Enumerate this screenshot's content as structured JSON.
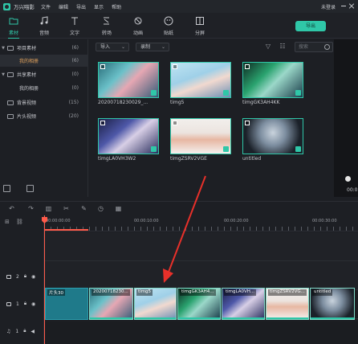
{
  "app": {
    "title": "万兴喵影",
    "menu": [
      "文件",
      "编辑",
      "导出",
      "显示",
      "帮助"
    ],
    "login": "未登录",
    "accent": "#2fc7a8"
  },
  "toolbar": {
    "tools": [
      {
        "label": "素材",
        "icon": "folder-icon"
      },
      {
        "label": "音频",
        "icon": "music-note-icon"
      },
      {
        "label": "文字",
        "icon": "text-icon"
      },
      {
        "label": "转场",
        "icon": "transition-icon"
      },
      {
        "label": "动画",
        "icon": "animation-icon"
      },
      {
        "label": "贴纸",
        "icon": "sticker-icon"
      },
      {
        "label": "分屏",
        "icon": "split-screen-icon"
      }
    ],
    "export_label": "导出"
  },
  "sidebar": {
    "items": [
      {
        "label": "项目素材",
        "count": "(6)"
      },
      {
        "label": "我的相册",
        "count": "(6)"
      },
      {
        "label": "共享素材",
        "count": "(0)"
      },
      {
        "label": "我的相册",
        "count": "(0)"
      },
      {
        "label": "背景视频",
        "count": "(15)"
      },
      {
        "label": "片头视频",
        "count": "(20)"
      }
    ]
  },
  "media": {
    "import_label": "导入",
    "sort_label": "录制",
    "search_placeholder": "搜索",
    "items": [
      {
        "name": "20200718230029_..."
      },
      {
        "name": "timg5"
      },
      {
        "name": "timgGK3AH4KK"
      },
      {
        "name": "timgLA0VH3W2"
      },
      {
        "name": "timgZSRV2VGE"
      },
      {
        "name": "untitled"
      }
    ]
  },
  "preview": {
    "time": "00:0"
  },
  "timeline": {
    "ruler_labels": [
      "00:00:00:00",
      "00:00:10:00",
      "00:00:20:00",
      "00:00:30:00"
    ],
    "clips": [
      {
        "label": "片头30"
      },
      {
        "label": "20200718230..."
      },
      {
        "label": "timg5"
      },
      {
        "label": "timgGK3AH4..."
      },
      {
        "label": "timgLA0VH..."
      },
      {
        "label": "timgZSRV2VG..."
      },
      {
        "label": "untitled"
      }
    ],
    "tracks": [
      {
        "label": "2",
        "icon": "video-track-icon"
      },
      {
        "label": "1",
        "icon": "video-track-icon"
      },
      {
        "label": "1",
        "icon": "audio-track-icon"
      }
    ]
  }
}
